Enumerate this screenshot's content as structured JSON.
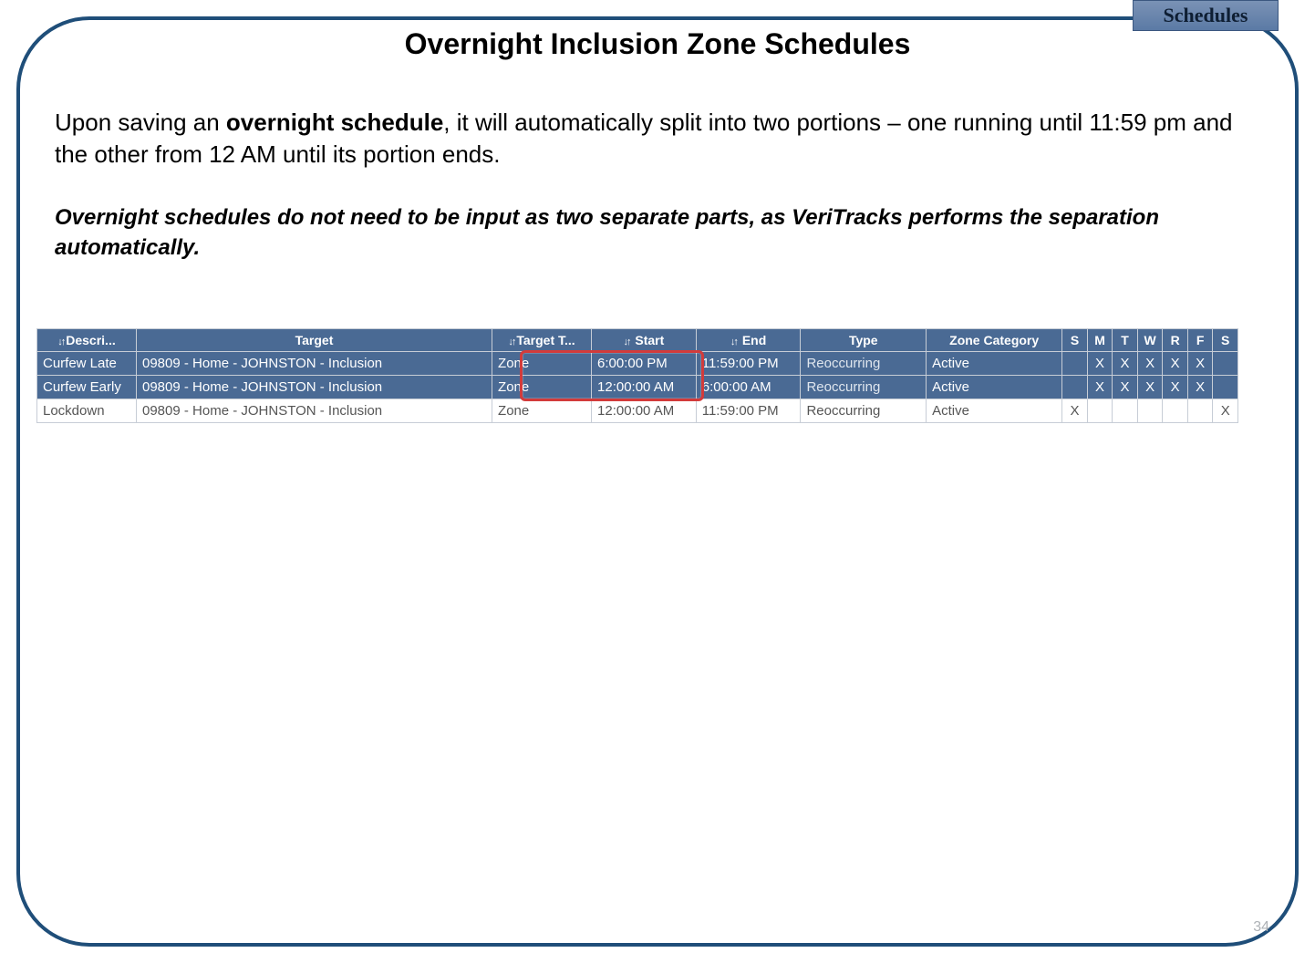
{
  "tab_label": "Schedules",
  "title": "Overnight Inclusion Zone Schedules",
  "paragraph_pre": "Upon saving an ",
  "paragraph_bold": "overnight schedule",
  "paragraph_post": ", it will automatically split into two portions – one running until 11:59 pm and the other from 12 AM until its portion ends.",
  "note": "Overnight schedules do not need to be input as two separate parts, as VeriTracks performs the separation automatically.",
  "page_number": "34",
  "table": {
    "headers": {
      "desc": "Descri...",
      "target": "Target",
      "target_t": "Target T...",
      "start": "Start",
      "end": "End",
      "type": "Type",
      "zone_cat": "Zone Category",
      "days": [
        "S",
        "M",
        "T",
        "W",
        "R",
        "F",
        "S"
      ]
    },
    "rows": [
      {
        "selected": true,
        "desc": "Curfew Late",
        "target": "09809 - Home - JOHNSTON - Inclusion",
        "target_t": "Zone",
        "start": "6:00:00 PM",
        "end": "11:59:00 PM",
        "type": "Reoccurring",
        "zone_cat": "Active",
        "days": [
          "",
          "X",
          "X",
          "X",
          "X",
          "X",
          ""
        ]
      },
      {
        "selected": true,
        "desc": "Curfew Early",
        "target": "09809 - Home - JOHNSTON - Inclusion",
        "target_t": "Zone",
        "start": "12:00:00 AM",
        "end": "6:00:00 AM",
        "type": "Reoccurring",
        "zone_cat": "Active",
        "days": [
          "",
          "X",
          "X",
          "X",
          "X",
          "X",
          ""
        ]
      },
      {
        "selected": false,
        "desc": "Lockdown",
        "target": "09809 - Home - JOHNSTON - Inclusion",
        "target_t": "Zone",
        "start": "12:00:00 AM",
        "end": "11:59:00 PM",
        "type": "Reoccurring",
        "zone_cat": "Active",
        "days": [
          "X",
          "",
          "",
          "",
          "",
          "",
          "X"
        ]
      }
    ]
  }
}
